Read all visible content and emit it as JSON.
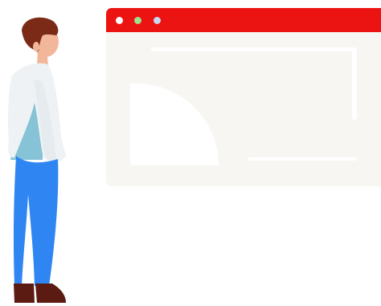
{
  "illustration": {
    "browser": {
      "titlebar_color": "#ec1313",
      "window_color": "#f7f6f3",
      "dots": {
        "close": "#ffffff",
        "minimize": "#9be28f",
        "maximize": "#c8d8f0"
      }
    },
    "person": {
      "hair_color": "#7a2a16",
      "skin_color": "#f2b79a",
      "shirt_color": "#eef2f4",
      "undershirt_color": "#86c3d6",
      "pants_color": "#2f86f2",
      "shoes_color": "#5b1b12"
    }
  }
}
